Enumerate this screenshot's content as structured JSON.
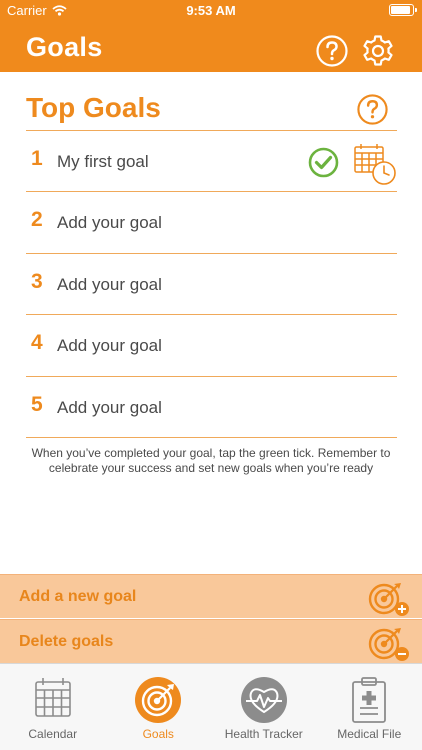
{
  "status_bar": {
    "carrier": "Carrier",
    "time": "9:53 AM"
  },
  "nav": {
    "title": "Goals",
    "help_icon": "question-circle-icon",
    "settings_icon": "gear-icon"
  },
  "content": {
    "title": "Top Goals",
    "help_icon": "question-circle-icon"
  },
  "goals": [
    {
      "number": "1",
      "text": "My first goal",
      "has_tick": true,
      "has_calendar": true
    },
    {
      "number": "2",
      "text": "Add your goal"
    },
    {
      "number": "3",
      "text": "Add your goal"
    },
    {
      "number": "4",
      "text": "Add your goal"
    },
    {
      "number": "5",
      "text": "Add your goal"
    }
  ],
  "hint": {
    "line1": "When you’ve completed your goal, tap the green tick. Remember to",
    "line2": "celebrate your success and set new goals when you’re ready"
  },
  "actions": {
    "add_label": "Add a new goal",
    "add_icon": "target-add-icon",
    "delete_label": "Delete goals",
    "delete_icon": "target-remove-icon"
  },
  "tabs": [
    {
      "label": "Calendar",
      "icon": "calendar-icon",
      "active": false
    },
    {
      "label": "Goals",
      "icon": "target-icon",
      "active": true
    },
    {
      "label": "Health Tracker",
      "icon": "heart-pulse-icon",
      "active": false
    },
    {
      "label": "Medical File",
      "icon": "clipboard-icon",
      "active": false
    }
  ],
  "colors": {
    "accent": "#f08a1c",
    "action_bg": "#f9c89a",
    "tick_green": "#6cb33f",
    "tab_active": "#ee8a1e",
    "tab_inactive": "#666666"
  }
}
